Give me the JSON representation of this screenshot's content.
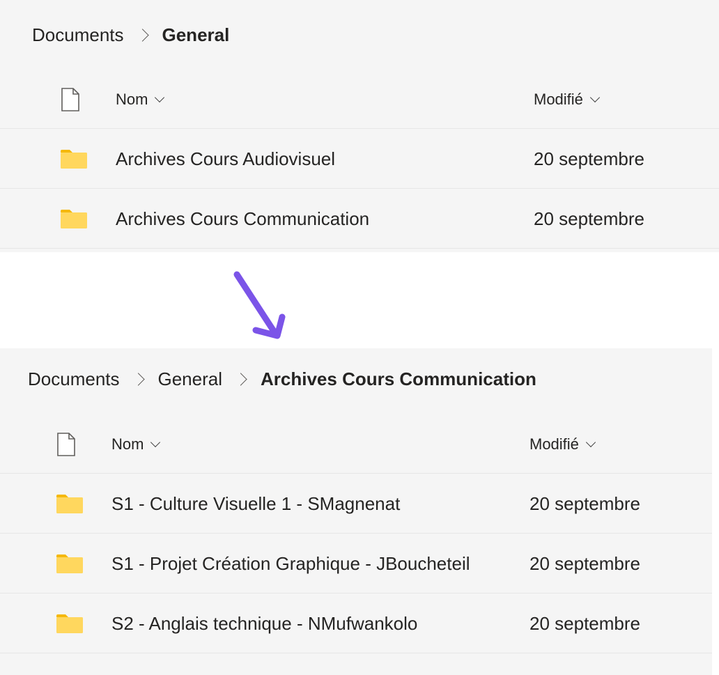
{
  "top_view": {
    "breadcrumb": [
      "Documents",
      "General"
    ],
    "columns": {
      "name": "Nom",
      "modified": "Modifié"
    },
    "rows": [
      {
        "name": "Archives Cours Audiovisuel",
        "modified": "20 septembre"
      },
      {
        "name": "Archives Cours Communication",
        "modified": "20 septembre"
      }
    ]
  },
  "bottom_view": {
    "breadcrumb": [
      "Documents",
      "General",
      "Archives Cours Communication"
    ],
    "columns": {
      "name": "Nom",
      "modified": "Modifié"
    },
    "rows": [
      {
        "name": "S1 - Culture Visuelle 1 - SMagnenat",
        "modified": "20 septembre"
      },
      {
        "name": "S1 - Projet Création Graphique - JBoucheteil",
        "modified": "20 septembre"
      },
      {
        "name": "S2 - Anglais technique - NMufwankolo",
        "modified": "20 septembre"
      }
    ]
  },
  "colors": {
    "accent_arrow": "#7b54e8",
    "folder": "#ffd75e",
    "folder_tab": "#f5b80a",
    "panel_bg": "#f5f5f5"
  },
  "icons": {
    "file": "document-icon",
    "folder": "folder-icon",
    "separator": "chevron-right-icon",
    "sort": "chevron-down-icon",
    "transition": "arrow-down-icon"
  }
}
